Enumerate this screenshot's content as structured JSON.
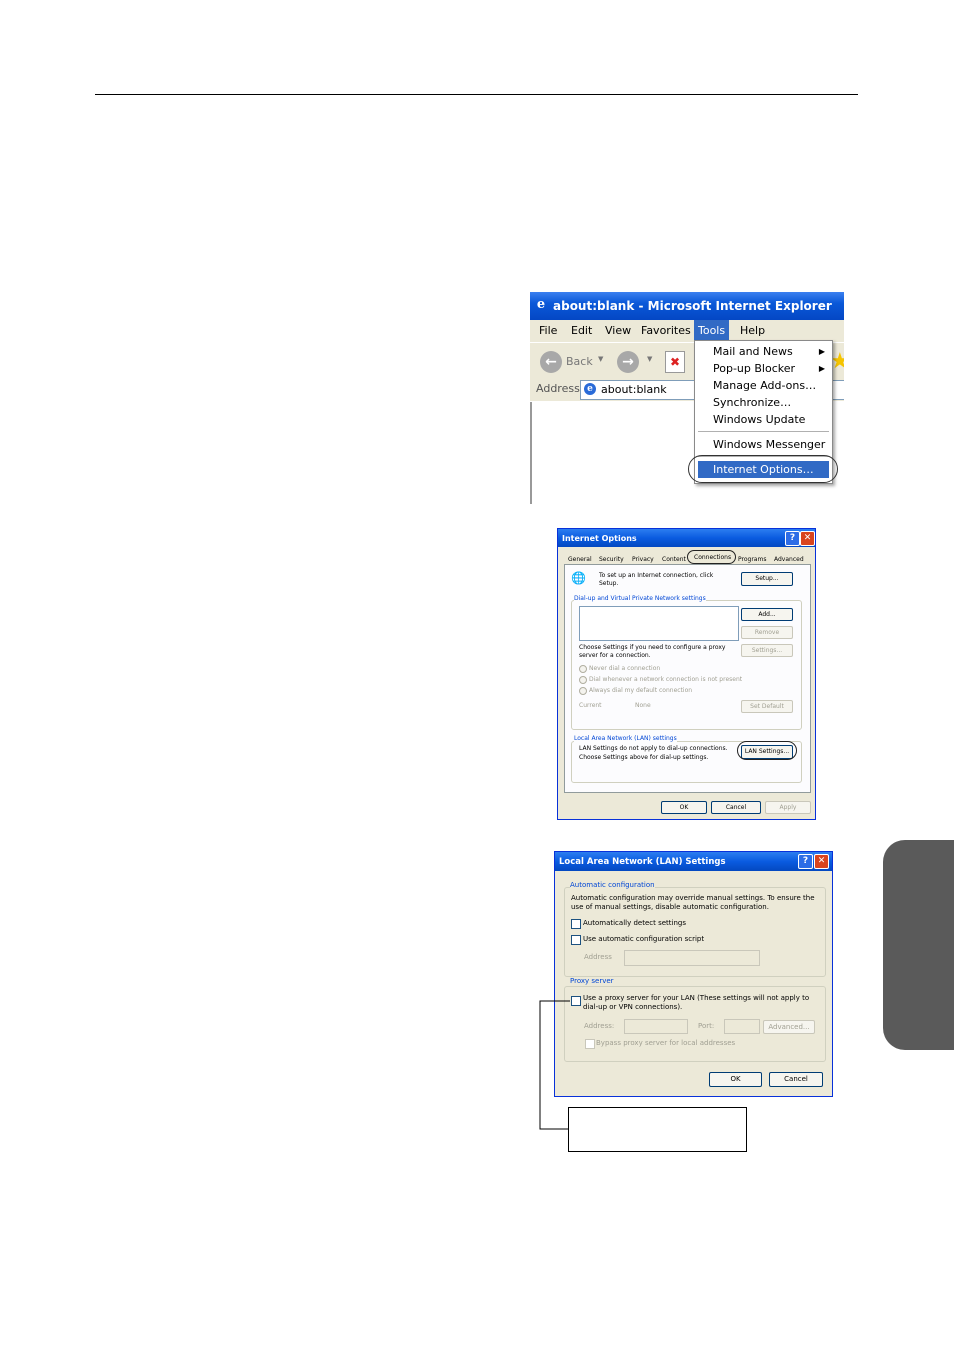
{
  "ie": {
    "title": "about:blank - Microsoft Internet Explorer",
    "menu": [
      "File",
      "Edit",
      "View",
      "Favorites",
      "Tools",
      "Help"
    ],
    "back_label": "Back",
    "address_label": "Address",
    "address_value": "about:blank",
    "tools_menu": {
      "items": [
        "Mail and News",
        "Pop-up Blocker",
        "Manage Add-ons…",
        "Synchronize…",
        "Windows Update",
        "Windows Messenger",
        "Internet Options…"
      ],
      "highlighted": "Internet Options…"
    }
  },
  "internet_options": {
    "title": "Internet Options",
    "tabs": [
      "General",
      "Security",
      "Privacy",
      "Content",
      "Connections",
      "Programs",
      "Advanced"
    ],
    "active_tab": "Connections",
    "setup_text_1": "To set up an Internet connection, click",
    "setup_text_2": "Setup.",
    "setup_button": "Setup...",
    "dialup_group": "Dial-up and Virtual Private Network settings",
    "add_button": "Add...",
    "remove_button": "Remove",
    "settings_button": "Settings...",
    "proxy_text_1": "Choose Settings if you need to configure a proxy",
    "proxy_text_2": "server for a connection.",
    "radio_1": "Never dial a connection",
    "radio_2": "Dial whenever a network connection is not present",
    "radio_3": "Always dial my default connection",
    "current_label": "Current",
    "current_value": "None",
    "set_default_button": "Set Default",
    "lan_group": "Local Area Network (LAN) settings",
    "lan_text_1": "LAN Settings do not apply to dial-up connections.",
    "lan_text_2": "Choose Settings above for dial-up settings.",
    "lan_button": "LAN Settings...",
    "ok": "OK",
    "cancel": "Cancel",
    "apply": "Apply"
  },
  "lan_settings": {
    "title": "Local Area Network (LAN) Settings",
    "auto_group": "Automatic configuration",
    "auto_text_1": "Automatic configuration may override manual settings.  To ensure the",
    "auto_text_2": "use of manual settings, disable automatic configuration.",
    "auto_detect": "Automatically detect settings",
    "auto_script": "Use automatic configuration script",
    "address_label": "Address",
    "proxy_group": "Proxy server",
    "proxy_check_1": "Use a proxy server for your LAN (These settings will not apply to",
    "proxy_check_2": "dial-up or VPN connections).",
    "proxy_address_label": "Address:",
    "port_label": "Port:",
    "advanced_button": "Advanced...",
    "bypass": "Bypass proxy server for local addresses",
    "ok": "OK",
    "cancel": "Cancel"
  },
  "callout_text": ""
}
